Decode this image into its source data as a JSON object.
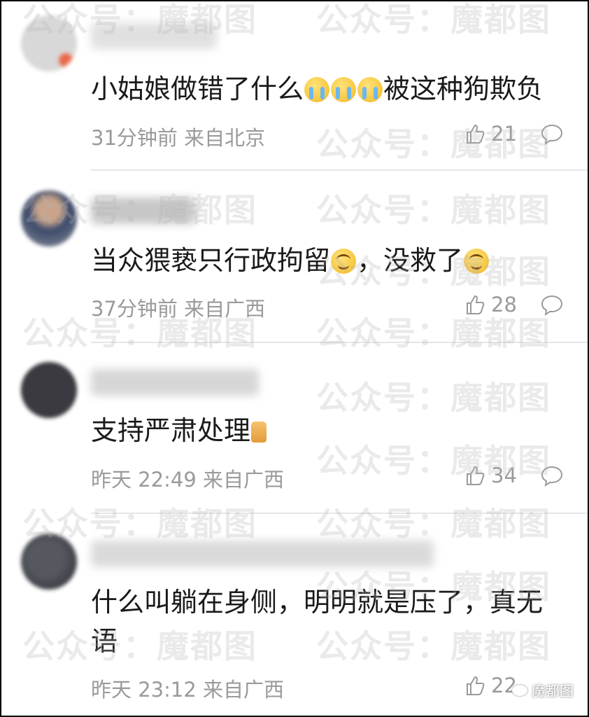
{
  "comments": [
    {
      "text_parts": [
        "小姑娘做错了什么",
        "被这种狗欺负"
      ],
      "time": "31分钟前",
      "location": "来自北京",
      "likes": "21",
      "avatar_color": "#c9c9c9"
    },
    {
      "text_parts": [
        "当众猥亵只行政拘留",
        "，没救了"
      ],
      "time": "37分钟前",
      "location": "来自广西",
      "likes": "28",
      "avatar_color": "#7b7f8c"
    },
    {
      "text_parts": [
        "支持严肃处理"
      ],
      "time": "昨天 22:49",
      "location": "来自广西",
      "likes": "34",
      "avatar_color": "#2f2f33"
    },
    {
      "text_parts": [
        "什么叫躺在身侧，明明就是压了，真无语"
      ],
      "time": "昨天 23:12",
      "location": "来自广西",
      "likes": "22",
      "avatar_color": "#3b3d45"
    }
  ],
  "watermark": {
    "text_left": "公众号：",
    "text_right": "魔都图"
  },
  "brand": {
    "label": "魔都图"
  },
  "icons": {
    "like": "thumbs-up-icon",
    "reply": "speech-bubble-icon",
    "cry_emoji": "crying-face-emoji",
    "smile_emoji": "smiling-face-emoji",
    "thumb_emoji": "thumbs-up-emoji"
  },
  "colors": {
    "text": "#1a1a1a",
    "meta": "#9a9a9a",
    "divider": "#e6e6e6",
    "watermark": "rgba(180,180,180,0.28)"
  }
}
